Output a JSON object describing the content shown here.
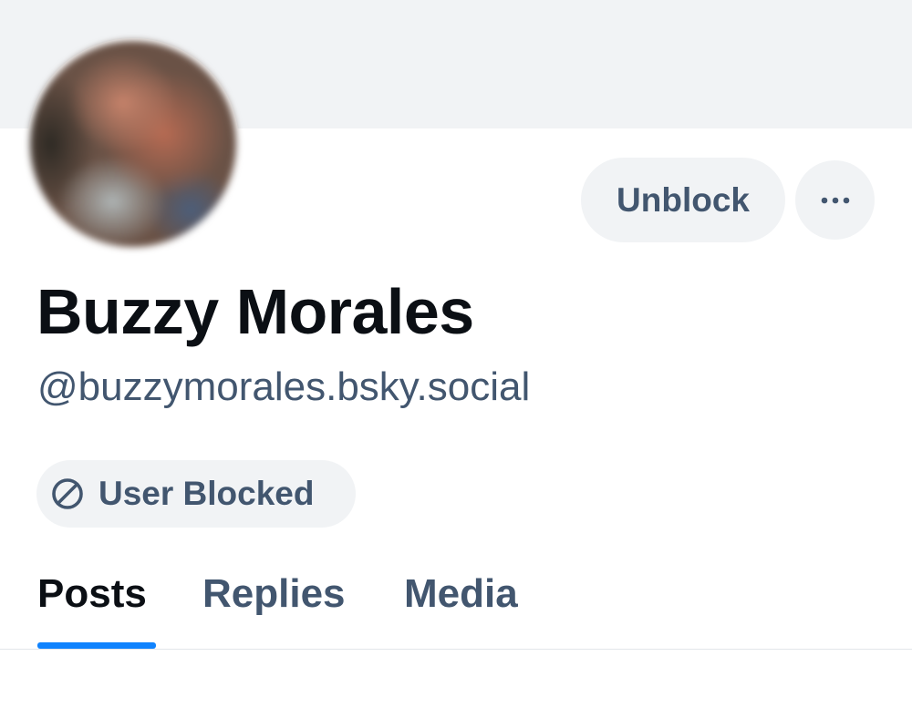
{
  "profile": {
    "display_name": "Buzzy Morales",
    "handle": "@buzzymorales.bsky.social"
  },
  "actions": {
    "unblock_label": "Unblock",
    "more_icon": "ellipsis-icon"
  },
  "status": {
    "blocked_label": "User Blocked",
    "blocked_icon": "no-entry-icon"
  },
  "tabs": [
    {
      "label": "Posts",
      "active": true
    },
    {
      "label": "Replies",
      "active": false
    },
    {
      "label": "Media",
      "active": false
    }
  ],
  "colors": {
    "accent": "#1083fe",
    "text_primary": "#0b0f14",
    "text_secondary": "#42566f",
    "surface": "#f1f3f5"
  }
}
